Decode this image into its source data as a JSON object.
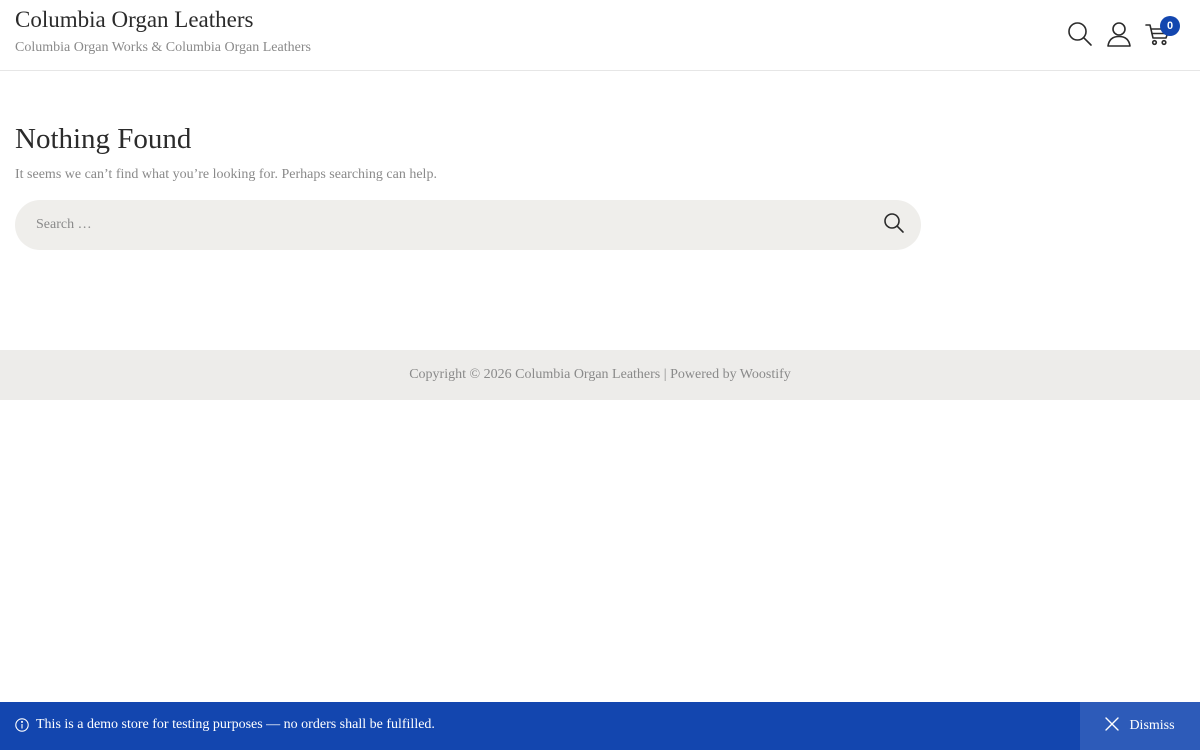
{
  "header": {
    "site_title": "Columbia Organ Leathers",
    "tagline": "Columbia Organ Works & Columbia Organ Leathers",
    "icons": [
      "search-icon",
      "user-icon",
      "cart-icon"
    ],
    "cart_count": "0"
  },
  "main": {
    "title": "Nothing Found",
    "text": "It seems we can’t find what you’re looking for. Perhaps searching can help.",
    "search": {
      "placeholder": "Search …",
      "value": ""
    }
  },
  "footer": {
    "copyright": "Copyright © 2026 Columbia Organ Leathers",
    "separator": " | ",
    "powered_by": "Powered by Woostify"
  },
  "store_notice": {
    "text": "This is a demo store for testing purposes — no orders shall be fulfilled.",
    "dismiss_label": "Dismiss"
  },
  "colors": {
    "accent": "#1346af",
    "footer_bg": "#edecea",
    "search_bg": "#efeeeb",
    "muted_text": "#8a8a8a"
  }
}
